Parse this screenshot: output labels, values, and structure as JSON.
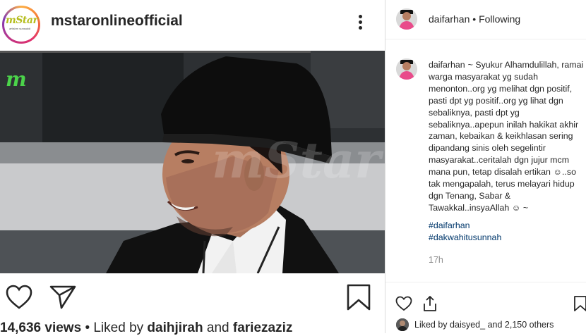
{
  "post": {
    "account_username": "mstaronlineofficial",
    "logo_text_main": "mStar",
    "logo_text_sub": "artisbm sunsaddi",
    "photo_watermark": "mStar",
    "views_count": "14,636 views",
    "liked_prefix": "• Liked by",
    "liked_user1": "daihjirah",
    "liked_and": "and",
    "liked_user2": "fariezaziz"
  },
  "comment": {
    "header_username": "daifarhan",
    "header_follow_status": "• Following",
    "author": "daifarhan",
    "caption_text": "~ Syukur Alhamdulillah, ramai warga masyarakat yg sudah menonton..org yg melihat dgn positif, pasti dpt yg positif..org yg lihat dgn sebaliknya, pasti dpt yg sebaliknya..apepun inilah hakikat akhir zaman, kebaikan & keikhlasan sering dipandang sinis oleh segelintir masyarakat..ceritalah dgn jujur mcm mana pun, tetap disalah ertikan ☺..so tak mengapalah, terus melayari hidup dgn Tenang, Sabar & Tawakkal..insyaAllah ☺ ~",
    "hashtags": [
      "#daifarhan",
      "#dakwahitusunnah"
    ],
    "time_ago": "17h",
    "liked_by_prefix": "Liked by",
    "liked_by_user": "daisyed_",
    "liked_by_suffix": "and 2,150 others"
  },
  "icons": [
    "more-icon",
    "heart-icon",
    "share-icon",
    "bookmark-icon",
    "upload-icon"
  ],
  "colors": {
    "link_blue": "#00376b",
    "secondary_text": "#8e8e8e",
    "primary_text": "#262626",
    "avatar_pink": "#e84b8a"
  }
}
